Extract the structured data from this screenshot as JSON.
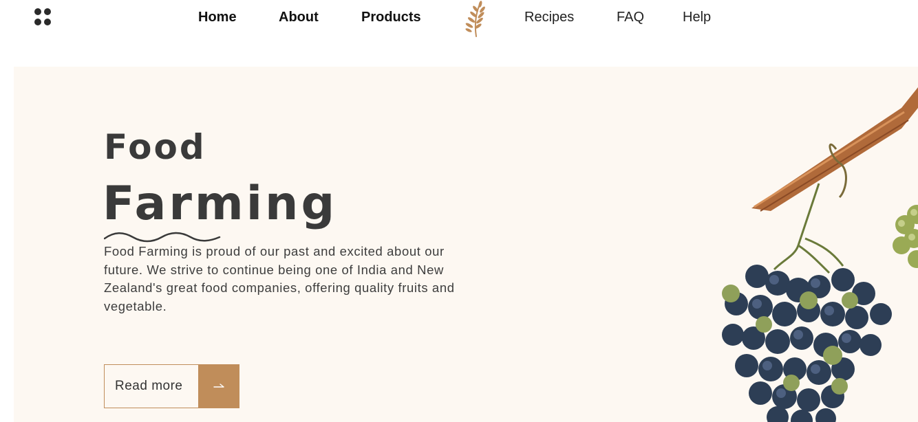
{
  "header": {
    "nav_left": [
      {
        "label": "Home"
      },
      {
        "label": "About"
      },
      {
        "label": "Products"
      }
    ],
    "nav_right": [
      {
        "label": "Recipes"
      },
      {
        "label": "FAQ"
      },
      {
        "label": "Help"
      }
    ],
    "menu_icon": "grid-dots-icon",
    "logo_icon": "wheat-leaf-icon"
  },
  "hero": {
    "title_line1": "Food",
    "title_line2": "Farming",
    "description": "Food Farming is proud of our past and excited about our future. We strive to continue being one of India and New Zealand's great food companies, offering quality fruits and vegetable.",
    "cta_label": "Read more",
    "cta_icon": "arrow-right-icon",
    "illustration": "grapes-illustration"
  },
  "colors": {
    "accent": "#c08d5a",
    "hero_bg": "#fdf8f2",
    "text_dark": "#3a3a3a"
  }
}
